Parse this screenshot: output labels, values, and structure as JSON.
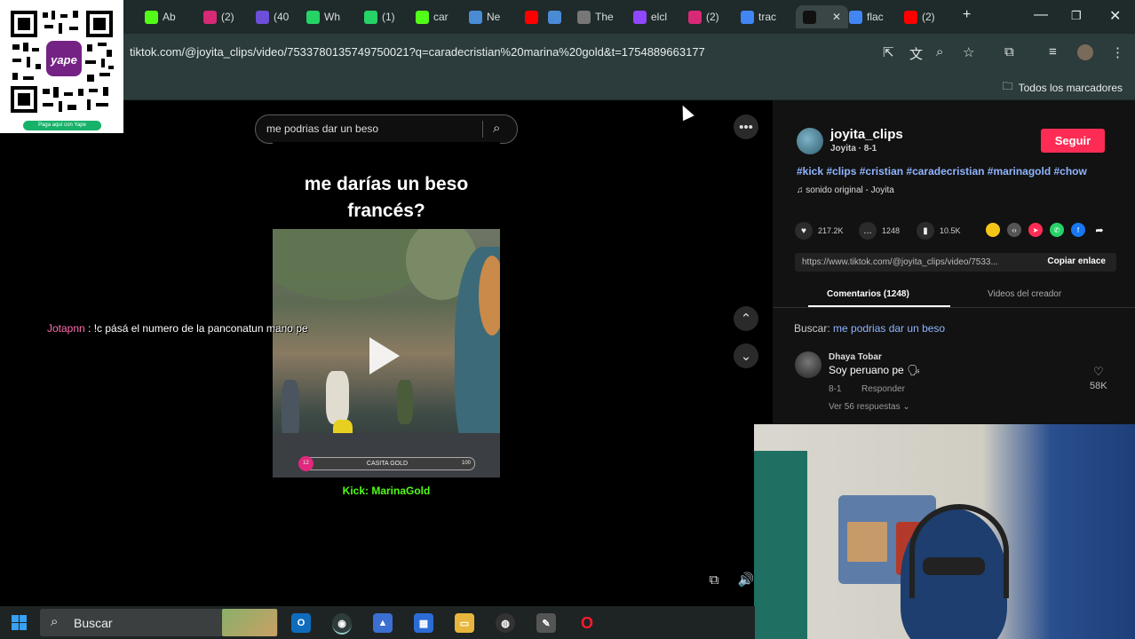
{
  "qr": {
    "caption": "Paga aquí con Yape",
    "brand": "yape"
  },
  "tabs": [
    {
      "icon": "kick-icon",
      "color": "#53fc18",
      "label": "Ab"
    },
    {
      "icon": "instagram-icon",
      "color": "#d62976",
      "label": "(2)"
    },
    {
      "icon": "chat-icon",
      "color": "#6c4fd8",
      "label": "(40"
    },
    {
      "icon": "whatsapp-icon",
      "color": "#25d366",
      "label": "Wh"
    },
    {
      "icon": "whatsapp-icon",
      "color": "#25d366",
      "label": "(1)"
    },
    {
      "icon": "kick-icon",
      "color": "#53fc18",
      "label": "car"
    },
    {
      "icon": "news-icon",
      "color": "#4a8bd6",
      "label": "Ne"
    },
    {
      "icon": "youtube-icon",
      "color": "#ff0000",
      "label": ""
    },
    {
      "icon": "window-icon",
      "color": "#4a8bd6",
      "label": ""
    },
    {
      "icon": "notion-icon",
      "color": "#777777",
      "label": "The"
    },
    {
      "icon": "twitch-icon",
      "color": "#9146ff",
      "label": "elcl"
    },
    {
      "icon": "instagram-icon",
      "color": "#d62976",
      "label": "(2)"
    },
    {
      "icon": "google-icon",
      "color": "#4285f4",
      "label": "trac"
    },
    {
      "icon": "tiktok-icon",
      "color": "#111111",
      "label": ""
    },
    {
      "icon": "google-icon",
      "color": "#4285f4",
      "label": "flac"
    },
    {
      "icon": "youtube-icon",
      "color": "#ff0000",
      "label": "(2)"
    }
  ],
  "browser": {
    "url": "tiktok.com/@joyita_clips/video/7533780135749750021?q=caradecristian%20marina%20gold&t=1754889663177",
    "bookmarks_all": "Todos los marcadores"
  },
  "search": {
    "value": "me podrias dar un beso"
  },
  "video": {
    "caption_line1": "me darías un beso",
    "caption_line2": "francés?",
    "gold_bar_left": "12",
    "gold_bar_label": "CASITA GOLD",
    "gold_bar_right": "100",
    "kick_label": "Kick: MarinaGold"
  },
  "chat": {
    "user": "Jotapnn",
    "message": " : !c pásá el numero de la panconatun mano pe"
  },
  "creator": {
    "username": "joyita_clips",
    "subline": "Joyita · 8-1",
    "follow_label": "Seguir",
    "hashtags": "#kick #clips #cristian #caradecristian #marinagold #chow",
    "music": "sonido original - Joyita"
  },
  "stats": {
    "likes": "217.2K",
    "comments": "1248",
    "saves": "10.5K"
  },
  "share_colors": [
    "#f5c518",
    "#555555",
    "#fe2c55",
    "#25d366",
    "#1877f2"
  ],
  "link": {
    "url": "https://www.tiktok.com/@joyita_clips/video/7533...",
    "copy_label": "Copiar enlace"
  },
  "panel_tabs": {
    "comments": "Comentarios (1248)",
    "videos": "Videos del creador"
  },
  "search_note": {
    "prefix": "Buscar: ",
    "term": "me podrias dar un beso"
  },
  "comment": {
    "name": "Dhaya Tobar",
    "text": "Soy peruano pe 🗣",
    "date": "8-1",
    "reply_label": "Responder",
    "more_label": "Ver 56 respuestas ⌄",
    "likes": "58K"
  },
  "taskbar": {
    "search_placeholder": "Buscar"
  }
}
